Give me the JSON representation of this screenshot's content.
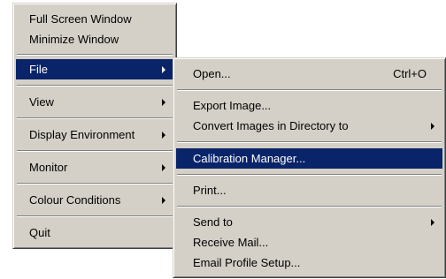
{
  "main_menu": {
    "items": [
      {
        "label": "Full Screen Window"
      },
      {
        "label": "Minimize Window"
      },
      {
        "label": "File"
      },
      {
        "label": "View"
      },
      {
        "label": "Display Environment"
      },
      {
        "label": "Monitor"
      },
      {
        "label": "Colour Conditions"
      },
      {
        "label": "Quit"
      }
    ]
  },
  "file_submenu": {
    "items": [
      {
        "label": "Open...",
        "shortcut": "Ctrl+O"
      },
      {
        "label": "Export Image..."
      },
      {
        "label": "Convert Images in Directory to"
      },
      {
        "label": "Calibration Manager..."
      },
      {
        "label": "Print..."
      },
      {
        "label": "Send to"
      },
      {
        "label": "Receive Mail..."
      },
      {
        "label": "Email Profile Setup..."
      }
    ]
  },
  "colors": {
    "menu_background": "#d4d0c8",
    "selection_background": "#0a246a",
    "selection_text": "#ffffff",
    "text": "#000000"
  }
}
